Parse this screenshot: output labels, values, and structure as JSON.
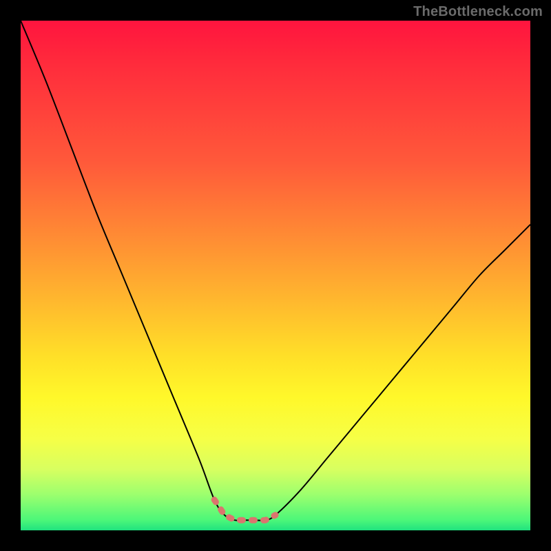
{
  "watermark": "TheBottleneck.com",
  "colors": {
    "background": "#000000",
    "gradient_top": "#ff143e",
    "gradient_bottom": "#1fe27f",
    "curve": "#000000",
    "good_band": "#db746e"
  },
  "chart_data": {
    "type": "line",
    "title": "",
    "xlabel": "",
    "ylabel": "",
    "xlim": [
      0,
      100
    ],
    "ylim": [
      0,
      100
    ],
    "grid": false,
    "series": [
      {
        "name": "bottleneck-curve",
        "x": [
          0,
          5,
          10,
          15,
          20,
          25,
          30,
          35,
          38,
          40,
          42,
          44,
          46,
          48,
          50,
          55,
          60,
          65,
          70,
          75,
          80,
          85,
          90,
          95,
          100
        ],
        "values": [
          100,
          88,
          75,
          62,
          50,
          38,
          26,
          14,
          6,
          3,
          2,
          2,
          2,
          2,
          3,
          8,
          14,
          20,
          26,
          32,
          38,
          44,
          50,
          55,
          60
        ]
      }
    ],
    "annotations": [
      {
        "name": "good-range",
        "type": "segment",
        "x_start": 38,
        "x_end": 50,
        "y": 3,
        "description": "dotted pink overlay marking optimal region at bottom of V"
      }
    ]
  }
}
